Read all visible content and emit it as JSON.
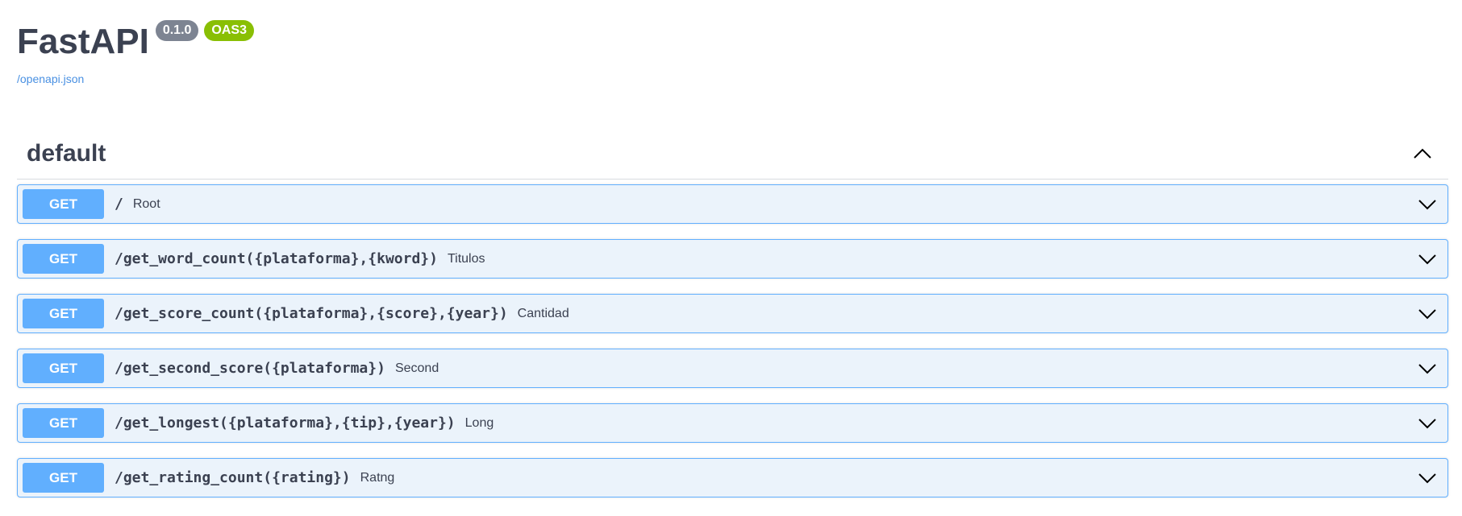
{
  "info": {
    "title": "FastAPI",
    "version_badge": "0.1.0",
    "oas_badge": "OAS3",
    "spec_link": "/openapi.json"
  },
  "tag": {
    "name": "default",
    "toggle_icon": "chevron-up-icon"
  },
  "operations": [
    {
      "method": "GET",
      "path": "/",
      "summary": "Root"
    },
    {
      "method": "GET",
      "path": "/get_word_count({plataforma},{kword})",
      "summary": "Titulos"
    },
    {
      "method": "GET",
      "path": "/get_score_count({plataforma},{score},{year})",
      "summary": "Cantidad"
    },
    {
      "method": "GET",
      "path": "/get_second_score({plataforma})",
      "summary": "Second"
    },
    {
      "method": "GET",
      "path": "/get_longest({plataforma},{tip},{year})",
      "summary": "Long"
    },
    {
      "method": "GET",
      "path": "/get_rating_count({rating})",
      "summary": "Ratng"
    }
  ],
  "colors": {
    "get_accent": "#61affe",
    "get_background": "#ebf3fb",
    "version_badge": "#7d8492",
    "oas_badge": "#89bf04",
    "link": "#4990e2"
  }
}
